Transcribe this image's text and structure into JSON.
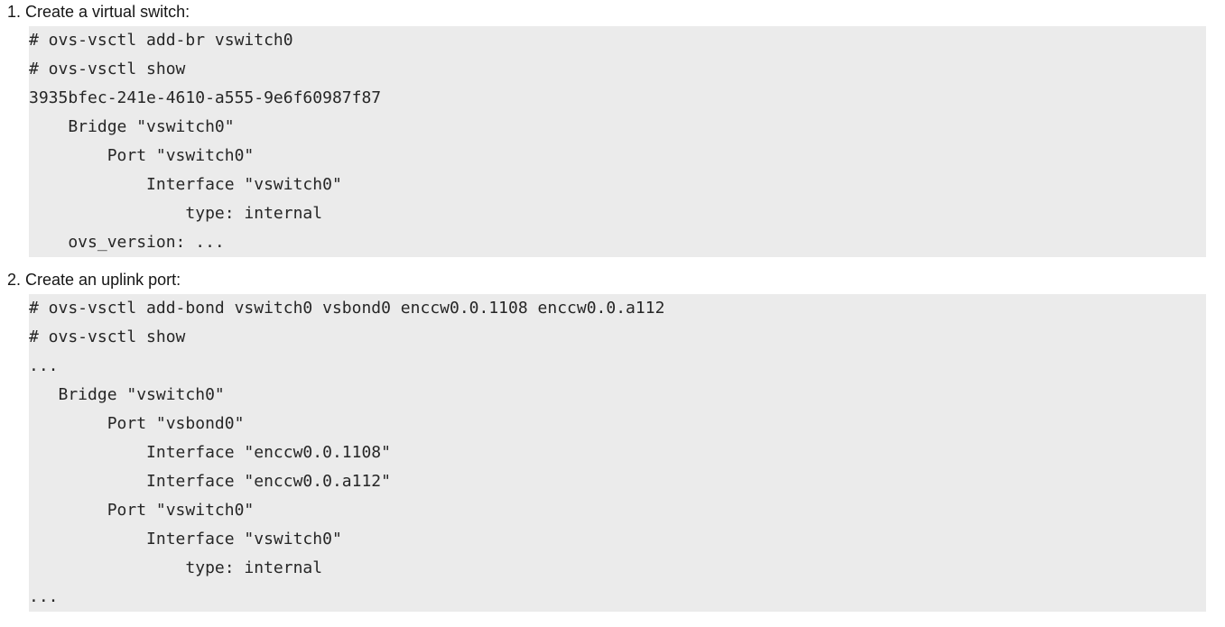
{
  "steps": [
    {
      "heading": "1. Create a virtual switch:",
      "code_lines": [
        "# ovs-vsctl add-br vswitch0",
        "# ovs-vsctl show",
        "3935bfec-241e-4610-a555-9e6f60987f87",
        "    Bridge \"vswitch0\"",
        "        Port \"vswitch0\"",
        "            Interface \"vswitch0\"",
        "                type: internal",
        "    ovs_version: ..."
      ]
    },
    {
      "heading": "2. Create an uplink port:",
      "code_lines": [
        "# ovs-vsctl add-bond vswitch0 vsbond0 enccw0.0.1108 enccw0.0.a112",
        "# ovs-vsctl show",
        "...",
        "   Bridge \"vswitch0\"",
        "        Port \"vsbond0\"",
        "            Interface \"enccw0.0.1108\"",
        "            Interface \"enccw0.0.a112\"",
        "        Port \"vswitch0\"",
        "            Interface \"vswitch0\"",
        "                type: internal",
        "..."
      ]
    }
  ]
}
